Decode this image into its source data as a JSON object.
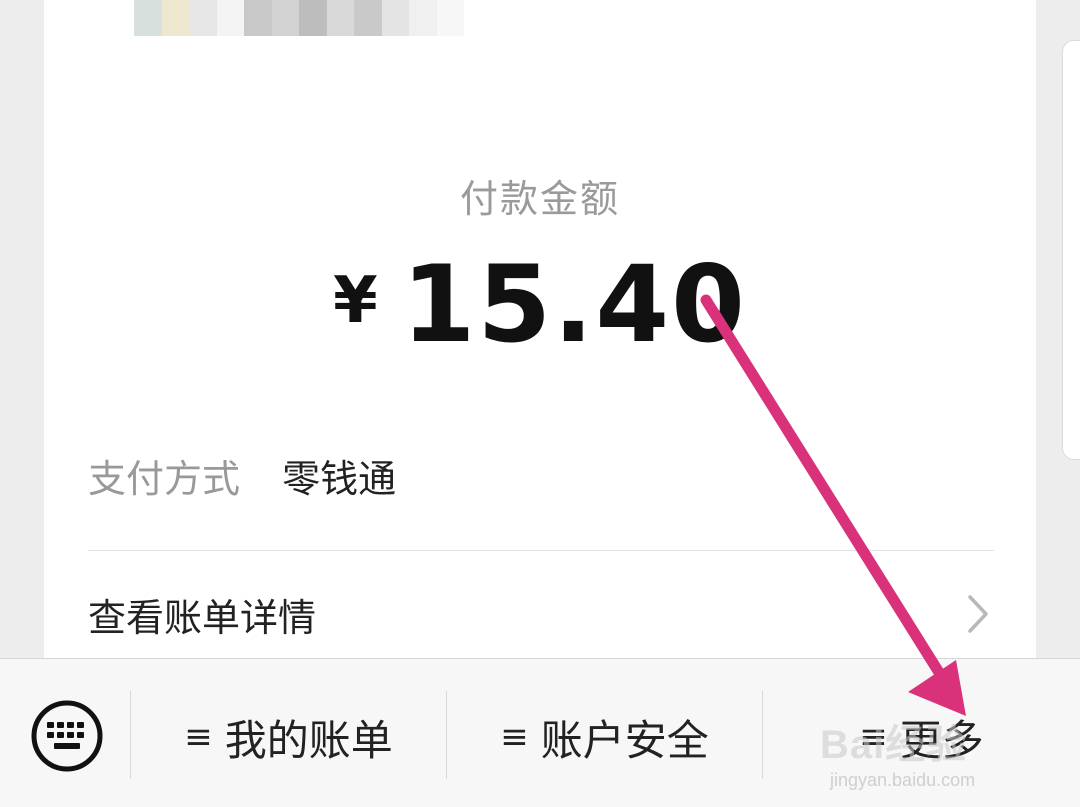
{
  "payment": {
    "label": "付款金额",
    "currency": "¥",
    "amount": "15.40"
  },
  "method": {
    "key": "支付方式",
    "value": "零钱通"
  },
  "details": {
    "label": "查看账单详情"
  },
  "tabbar": {
    "items": [
      {
        "label": "我的账单",
        "icon": "menu-icon"
      },
      {
        "label": "账户安全",
        "icon": "menu-icon"
      },
      {
        "label": "更多",
        "icon": "menu-icon"
      }
    ],
    "menu_glyph": "≡"
  },
  "watermark": {
    "line1": "Bai经验",
    "line2": "jingyan.baidu.com"
  },
  "colors": {
    "arrow": "#d9327a",
    "background": "#ededed",
    "card": "#ffffff"
  }
}
